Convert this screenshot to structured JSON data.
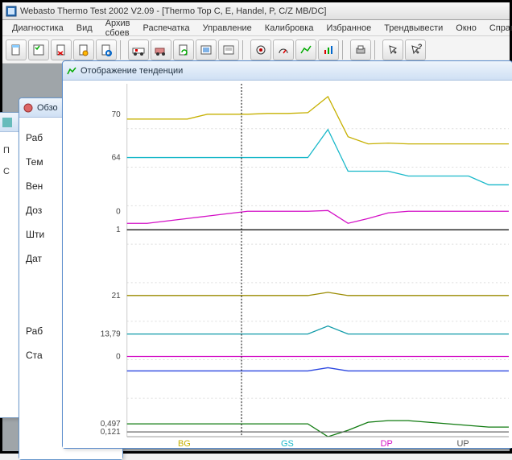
{
  "window": {
    "title": "Webasto Thermo Test 2002 V2.09 - [Thermo Top C, E, Handel, P, C/Z MB/DC]"
  },
  "menu": {
    "items": [
      "Диагностика",
      "Вид",
      "Архив сбоев",
      "Распечатка",
      "Управление",
      "Калибровка",
      "Избранное",
      "Трендвывести",
      "Окно",
      "Справка"
    ]
  },
  "toolbar": {
    "buttons": [
      "doc-new-icon",
      "checklist-icon",
      "doc-x-icon",
      "doc-wrench-icon",
      "doc-gear-icon",
      "sep",
      "ambulance-icon",
      "truck-icon",
      "doc-refresh-icon",
      "list-icon",
      "list-alt-icon",
      "sep",
      "circle-dot-icon",
      "gauge-icon",
      "chart-icon",
      "chart-bars-icon",
      "sep",
      "print-icon",
      "sep",
      "pointer-icon",
      "help-pointer-icon"
    ]
  },
  "child_windows": {
    "bg1_rows": [
      "П",
      "С"
    ],
    "overview": {
      "title": "Обзо",
      "rows": [
        "Раб",
        "Тем",
        "Вен",
        "Доз",
        "Шти",
        "Дат",
        "",
        "",
        "Раб",
        "Ста"
      ]
    },
    "trend": {
      "title": "Отображение тенденции"
    }
  },
  "chart_data": {
    "type": "line",
    "x_range": [
      0,
      100
    ],
    "cursor_x": 30,
    "series": [
      {
        "name": "BG_top",
        "color": "#c6b000",
        "label_value": "70",
        "values_y": [
          48,
          48,
          48,
          48,
          42,
          42,
          42,
          41,
          41,
          40,
          20,
          70,
          79,
          78,
          79,
          79,
          79,
          79,
          79,
          79
        ]
      },
      {
        "name": "GS_top",
        "color": "#18b8c9",
        "label_value": "64",
        "values_y": [
          96,
          96,
          96,
          96,
          96,
          96,
          96,
          96,
          96,
          96,
          61,
          113,
          113,
          113,
          119,
          119,
          119,
          119,
          130,
          130
        ]
      },
      {
        "name": "DP_top",
        "color": "#d410c6",
        "label_value": "0",
        "values_y": [
          178,
          178,
          175,
          172,
          169,
          166,
          163,
          163,
          163,
          163,
          162,
          178,
          172,
          165,
          163,
          163,
          163,
          163,
          163,
          163
        ]
      },
      {
        "name": "black_step",
        "color": "#222",
        "label_value": "1",
        "values_y": [
          186,
          186,
          186,
          186,
          186,
          186,
          186,
          186,
          186,
          186,
          186,
          186,
          186,
          186,
          186,
          186,
          186,
          186,
          186,
          186
        ]
      },
      {
        "name": "olive_mid",
        "color": "#9a8b00",
        "label_value": "21",
        "values_y": [
          268,
          268,
          268,
          268,
          268,
          268,
          268,
          268,
          268,
          268,
          264,
          268,
          268,
          268,
          268,
          268,
          268,
          268,
          268,
          268
        ]
      },
      {
        "name": "teal_mid",
        "color": "#0f9aa8",
        "label_value": "13,79",
        "values_y": [
          316,
          316,
          316,
          316,
          316,
          316,
          316,
          316,
          316,
          316,
          306,
          316,
          316,
          316,
          316,
          316,
          316,
          316,
          316,
          316
        ]
      },
      {
        "name": "magenta_flat",
        "color": "#d410c6",
        "label_value": "0",
        "values_y": [
          344,
          344,
          344,
          344,
          344,
          344,
          344,
          344,
          344,
          344,
          344,
          344,
          344,
          344,
          344,
          344,
          344,
          344,
          344,
          344
        ]
      },
      {
        "name": "blue_flat",
        "color": "#2a46e0",
        "label_value": "",
        "values_y": [
          362,
          362,
          362,
          362,
          362,
          362,
          362,
          362,
          362,
          362,
          358,
          362,
          362,
          362,
          362,
          362,
          362,
          362,
          362,
          362
        ]
      },
      {
        "name": "green_low",
        "color": "#0f7a0f",
        "label_value": "0,497",
        "values_y": [
          428,
          428,
          428,
          428,
          428,
          428,
          428,
          428,
          428,
          428,
          444,
          436,
          426,
          424,
          424,
          426,
          428,
          430,
          432,
          432
        ]
      },
      {
        "name": "gray_low",
        "color": "#666",
        "label_value": "0,121",
        "values_y": [
          438,
          438,
          438,
          438,
          438,
          438,
          438,
          438,
          438,
          438,
          438,
          438,
          438,
          438,
          438,
          438,
          438,
          438,
          438,
          438
        ]
      }
    ],
    "x_axis": {
      "labels": [
        {
          "text": "BG",
          "color": "#c6b000",
          "pos": 15
        },
        {
          "text": "GS",
          "color": "#18b8c9",
          "pos": 42
        },
        {
          "text": "DP",
          "color": "#d410c6",
          "pos": 68
        },
        {
          "text": "UP",
          "color": "#555",
          "pos": 88
        }
      ]
    }
  },
  "colors": {
    "bg_gold": "#c6b000",
    "gs_teal": "#18b8c9",
    "dp_magenta": "#d410c6",
    "dark_green": "#0f7a0f"
  }
}
